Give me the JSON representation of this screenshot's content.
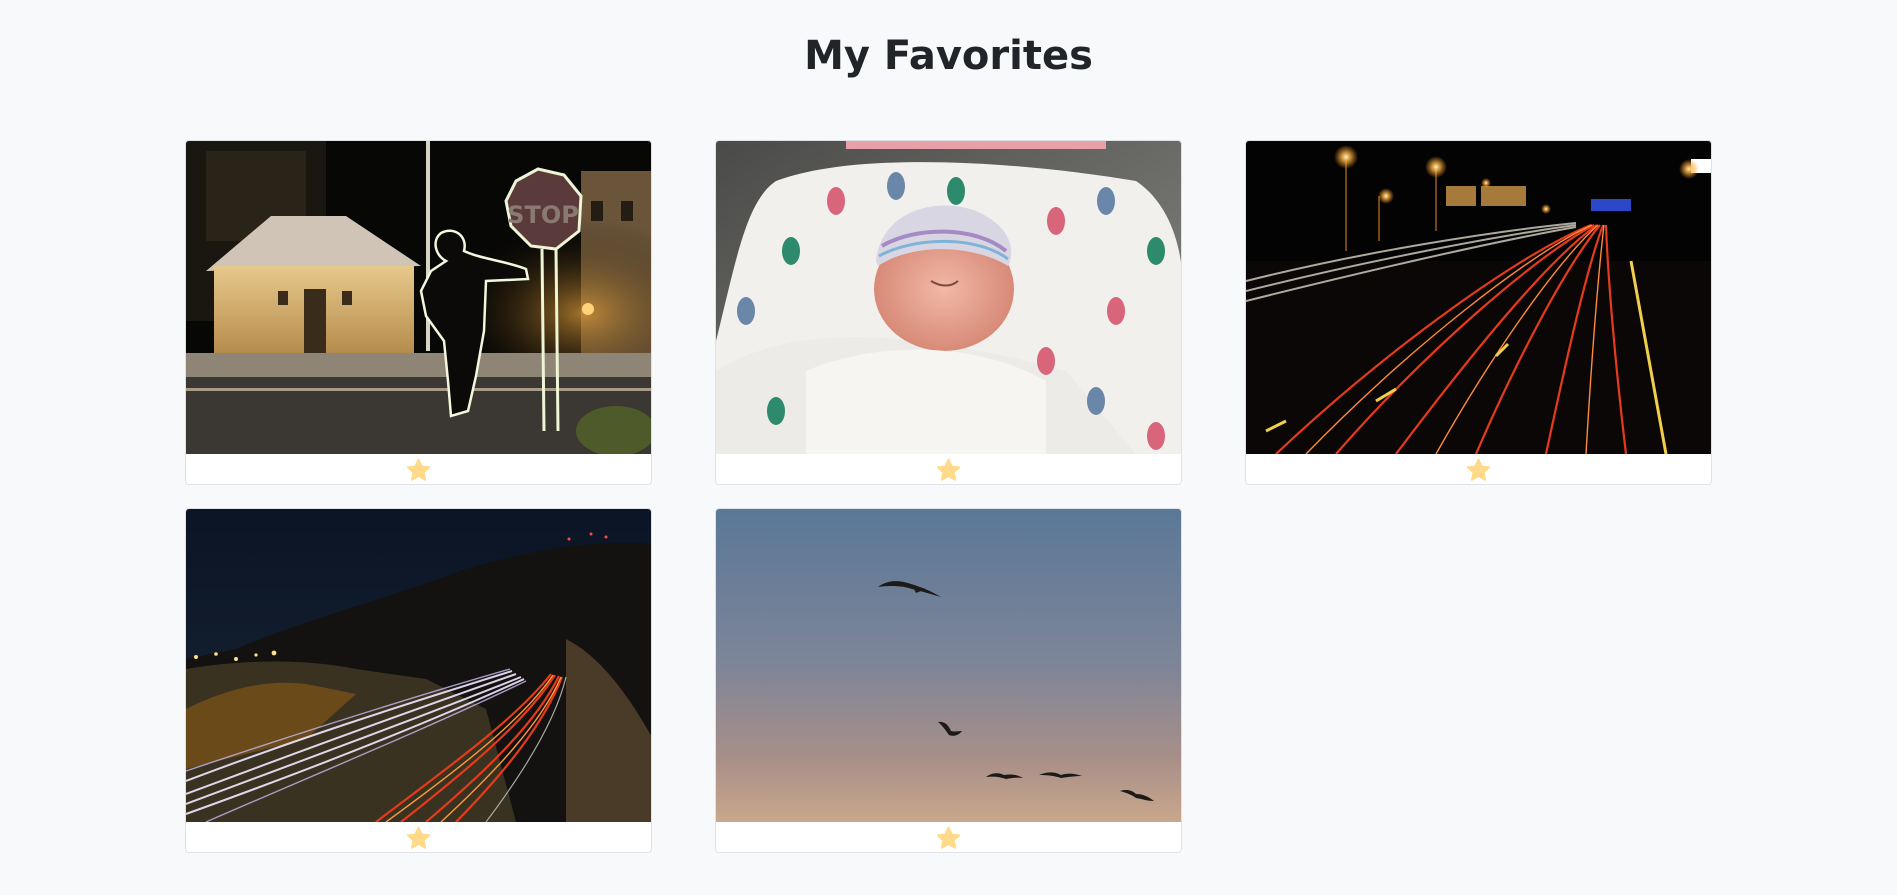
{
  "page": {
    "title": "My Favorites"
  },
  "colors": {
    "background": "#f8f9fa",
    "card_background": "#ffffff",
    "card_border": "#dfe2e5",
    "star": "#ffda8a",
    "title_text": "#212529"
  },
  "photos": [
    {
      "subject": "light painting silhouette leaning on stop sign at night",
      "sign_text": "STOP",
      "favorite": true,
      "favorite_icon": "star-icon"
    },
    {
      "subject": "newborn baby sleeping in footprint-patterned blanket",
      "favorite": true,
      "favorite_icon": "star-icon"
    },
    {
      "subject": "highway light trails at night",
      "favorite": true,
      "favorite_icon": "star-icon"
    },
    {
      "subject": "curving mountain highway light trails at night",
      "favorite": true,
      "favorite_icon": "star-icon"
    },
    {
      "subject": "birds flying in dusk sky",
      "favorite": true,
      "favorite_icon": "star-icon"
    }
  ]
}
